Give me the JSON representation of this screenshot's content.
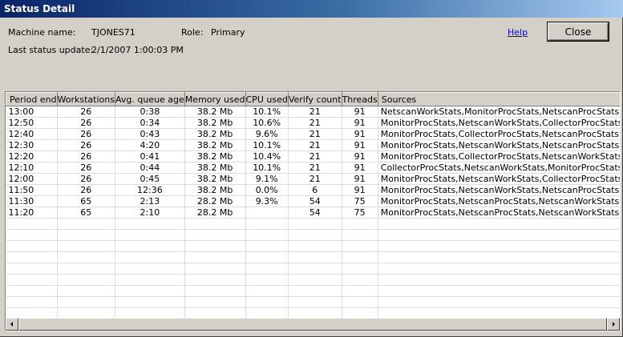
{
  "window": {
    "title": "Status Detail"
  },
  "info": {
    "machine_label": "Machine name:",
    "machine_value": "TJONES71",
    "role_label": "Role:",
    "role_value": "Primary",
    "update_label": "Last status update:",
    "update_value": "2/1/2007 1:00:03 PM"
  },
  "actions": {
    "help_label": "Help",
    "close_label": "Close"
  },
  "table": {
    "columns": [
      "Period end",
      "Workstations",
      "Avg. queue age",
      "Memory used",
      "CPU used",
      "Verify count",
      "Threads",
      "Sources"
    ],
    "rows": [
      [
        "13:00",
        "26",
        "0:38",
        "38.2 Mb",
        "10.1%",
        "21",
        "91",
        "NetscanWorkStats,MonitorProcStats,NetscanProcStats"
      ],
      [
        "12:50",
        "26",
        "0:34",
        "38.2 Mb",
        "10.6%",
        "21",
        "91",
        "MonitorProcStats,NetscanWorkStats,CollectorProcStats"
      ],
      [
        "12:40",
        "26",
        "0:43",
        "38.2 Mb",
        "9.6%",
        "21",
        "91",
        "MonitorProcStats,CollectorProcStats,NetscanProcStats"
      ],
      [
        "12:30",
        "26",
        "4:20",
        "38.2 Mb",
        "10.1%",
        "21",
        "91",
        "MonitorProcStats,NetscanWorkStats,NetscanProcStats"
      ],
      [
        "12:20",
        "26",
        "0:41",
        "38.2 Mb",
        "10.4%",
        "21",
        "91",
        "MonitorProcStats,CollectorProcStats,NetscanWorkStats"
      ],
      [
        "12:10",
        "26",
        "0:44",
        "38.2 Mb",
        "10.1%",
        "21",
        "91",
        "CollectorProcStats,NetscanWorkStats,MonitorProcStats"
      ],
      [
        "12:00",
        "26",
        "0:45",
        "38.2 Mb",
        "9.1%",
        "21",
        "91",
        "MonitorProcStats,NetscanWorkStats,CollectorProcStats"
      ],
      [
        "11:50",
        "26",
        "12:36",
        "38.2 Mb",
        "0.0%",
        "6",
        "91",
        "MonitorProcStats,NetscanWorkStats,NetscanProcStats"
      ],
      [
        "11:30",
        "65",
        "2:13",
        "28.2 Mb",
        "9.3%",
        "54",
        "75",
        "MonitorProcStats,NetscanProcStats,NetscanWorkStats"
      ],
      [
        "11:20",
        "65",
        "2:10",
        "28.2 Mb",
        "",
        "54",
        "75",
        "MonitorProcStats,NetscanProcStats,NetscanWorkStats"
      ]
    ]
  },
  "icons": {
    "scroll_left": "left-arrow-icon",
    "scroll_right": "right-arrow-icon"
  }
}
